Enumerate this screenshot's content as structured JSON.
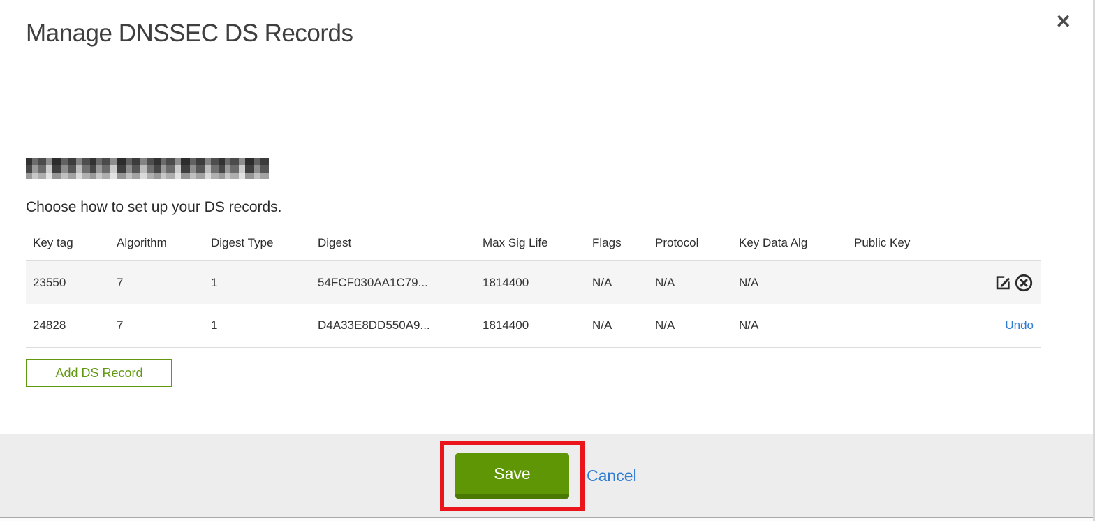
{
  "dialog": {
    "title": "Manage DNSSEC DS Records",
    "close_glyph": "✕",
    "instruction": "Choose how to set up your DS records.",
    "domain_redacted": true,
    "add_button_label": "Add DS Record",
    "save_label": "Save",
    "cancel_label": "Cancel",
    "undo_label": "Undo"
  },
  "table": {
    "headers": [
      "Key tag",
      "Algorithm",
      "Digest Type",
      "Digest",
      "Max Sig Life",
      "Flags",
      "Protocol",
      "Key Data Alg",
      "Public Key"
    ],
    "rows": [
      {
        "key_tag": "23550",
        "algorithm": "7",
        "digest_type": "1",
        "digest": "54FCF030AA1C79...",
        "max_sig_life": "1814400",
        "flags": "N/A",
        "protocol": "N/A",
        "key_data_alg": "N/A",
        "public_key": "",
        "state": "normal",
        "actions": [
          "edit",
          "delete"
        ]
      },
      {
        "key_tag": "24828",
        "algorithm": "7",
        "digest_type": "1",
        "digest": "D4A33E8DD550A9...",
        "max_sig_life": "1814400",
        "flags": "N/A",
        "protocol": "N/A",
        "key_data_alg": "N/A",
        "public_key": "",
        "state": "deleted",
        "actions": [
          "undo"
        ]
      }
    ]
  },
  "colors": {
    "save_green": "#5f9605",
    "save_green_dark": "#4a7a04",
    "outline_green": "#61980f",
    "link_blue": "#2f7dd3",
    "annotation_red": "#e9151b",
    "row_gray": "#f5f5f5",
    "footer_gray": "#ededed",
    "title_gray": "#3f3f3f"
  }
}
